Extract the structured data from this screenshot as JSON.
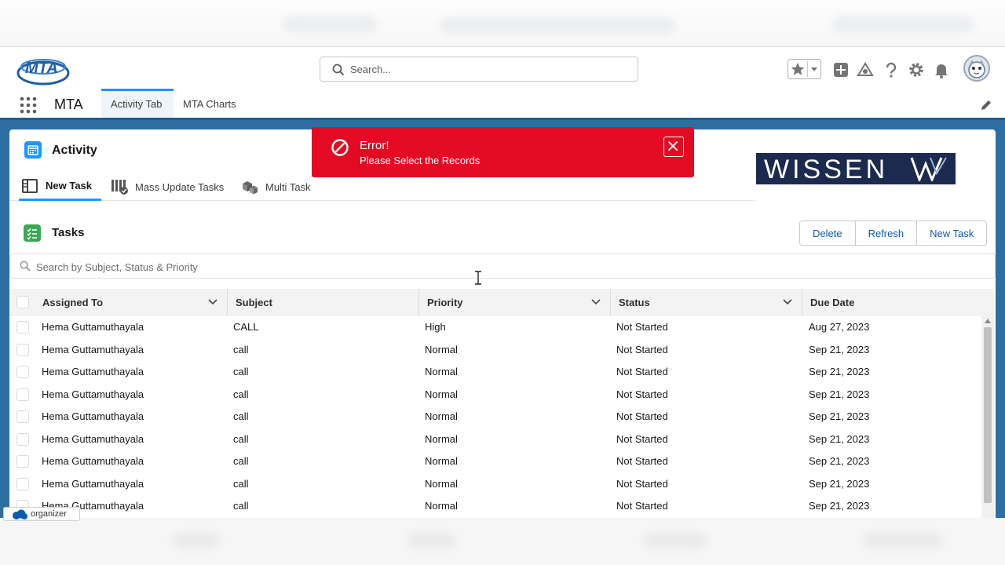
{
  "app": {
    "logo_text": "MTA",
    "name": "MTA"
  },
  "global_search": {
    "placeholder": "Search..."
  },
  "nav": {
    "tabs": [
      {
        "label": "Activity Tab",
        "active": true
      },
      {
        "label": "MTA Charts",
        "active": false
      }
    ]
  },
  "activity": {
    "title": "Activity",
    "subtabs": [
      {
        "label": "New Task",
        "icon": "new-task-icon",
        "active": true
      },
      {
        "label": "Mass Update Tasks",
        "icon": "mass-update-icon",
        "active": false
      },
      {
        "label": "Multi Task",
        "icon": "multi-task-icon",
        "active": false
      }
    ],
    "brand_logo": "WISSEN"
  },
  "tasks": {
    "title": "Tasks",
    "buttons": {
      "delete": "Delete",
      "refresh": "Refresh",
      "new_task": "New Task"
    },
    "search_placeholder": "Search by Subject, Status & Priority",
    "columns": [
      "Assigned To",
      "Subject",
      "Priority",
      "Status",
      "Due Date"
    ],
    "rows": [
      [
        "Hema Guttamuthayala",
        "CALL",
        "High",
        "Not Started",
        "Aug 27, 2023"
      ],
      [
        "Hema Guttamuthayala",
        "call",
        "Normal",
        "Not Started",
        "Sep 21, 2023"
      ],
      [
        "Hema Guttamuthayala",
        "call",
        "Normal",
        "Not Started",
        "Sep 21, 2023"
      ],
      [
        "Hema Guttamuthayala",
        "call",
        "Normal",
        "Not Started",
        "Sep 21, 2023"
      ],
      [
        "Hema Guttamuthayala",
        "call",
        "Normal",
        "Not Started",
        "Sep 21, 2023"
      ],
      [
        "Hema Guttamuthayala",
        "call",
        "Normal",
        "Not Started",
        "Sep 21, 2023"
      ],
      [
        "Hema Guttamuthayala",
        "call",
        "Normal",
        "Not Started",
        "Sep 21, 2023"
      ],
      [
        "Hema Guttamuthayala",
        "call",
        "Normal",
        "Not Started",
        "Sep 21, 2023"
      ],
      [
        "Hema Guttamuthayala",
        "call",
        "Normal",
        "Not Started",
        "Sep 21, 2023"
      ]
    ]
  },
  "toast": {
    "title": "Error!",
    "message": "Please Select the Records",
    "color": "#e20b23"
  },
  "extension_badge": {
    "label": "organizer"
  },
  "colors": {
    "brand_bar": "#1e5d8c",
    "workspace_bg": "#2e6ea3",
    "link": "#0b5cab",
    "active_tab": "#1b96ff"
  }
}
